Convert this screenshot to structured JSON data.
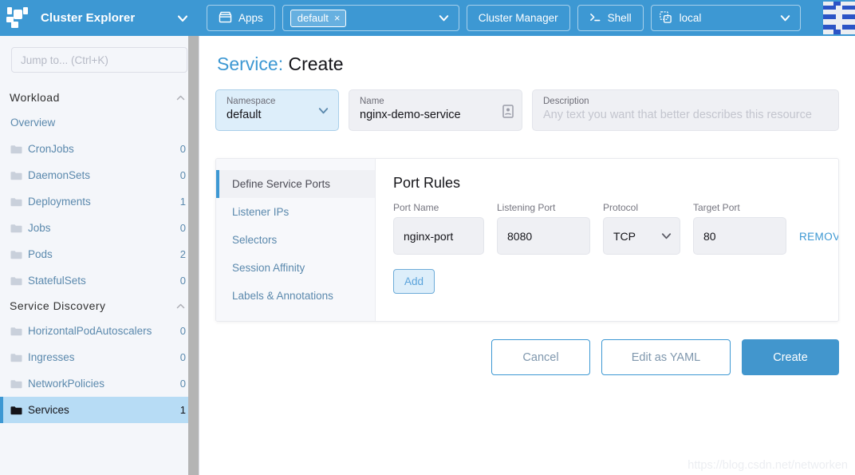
{
  "brand": {
    "logo_icon": "rancher-cow-logo",
    "title": "Cluster Explorer",
    "chevron_icon": "chevron-down-icon"
  },
  "topbar": {
    "apps_label": "Apps",
    "apps_icon": "apps-store-icon",
    "namespace_pill": "default",
    "namespace_pill_close": "×",
    "namespace_caret_icon": "chevron-down-icon",
    "cluster_manager_label": "Cluster Manager",
    "shell_label": "Shell",
    "shell_icon": "terminal-prompt-icon",
    "cluster_name": "local",
    "cluster_icon": "cluster-nodes-icon",
    "cluster_caret_icon": "chevron-down-icon",
    "avatar_icon": "user-avatar-flag"
  },
  "sidebar": {
    "search_placeholder": "Jump to... (Ctrl+K)",
    "scrollbar_icon": "vertical-scrollbar",
    "groups": [
      {
        "title": "Workload",
        "collapse_icon": "chevron-up-icon",
        "items": [
          {
            "label": "Overview",
            "count": "",
            "icon": "",
            "active": false
          },
          {
            "label": "CronJobs",
            "count": "0",
            "icon": "folder-icon",
            "active": false
          },
          {
            "label": "DaemonSets",
            "count": "0",
            "icon": "folder-icon",
            "active": false
          },
          {
            "label": "Deployments",
            "count": "1",
            "icon": "folder-icon",
            "active": false
          },
          {
            "label": "Jobs",
            "count": "0",
            "icon": "folder-icon",
            "active": false
          },
          {
            "label": "Pods",
            "count": "2",
            "icon": "folder-icon",
            "active": false
          },
          {
            "label": "StatefulSets",
            "count": "0",
            "icon": "folder-icon",
            "active": false
          }
        ]
      },
      {
        "title": "Service Discovery",
        "collapse_icon": "chevron-up-icon",
        "items": [
          {
            "label": "HorizontalPodAutoscalers",
            "count": "0",
            "icon": "folder-icon",
            "active": false
          },
          {
            "label": "Ingresses",
            "count": "0",
            "icon": "folder-icon",
            "active": false
          },
          {
            "label": "NetworkPolicies",
            "count": "0",
            "icon": "folder-icon",
            "active": false
          },
          {
            "label": "Services",
            "count": "1",
            "icon": "folder-icon",
            "active": true
          }
        ]
      }
    ]
  },
  "page": {
    "title_accent": "Service:",
    "title_rest": "Create",
    "namespace_label": "Namespace",
    "namespace_value": "default",
    "namespace_caret_icon": "chevron-down-icon",
    "name_label": "Name",
    "name_value": "nginx-demo-service",
    "name_icon": "id-badge-icon",
    "description_label": "Description",
    "description_placeholder": "Any text you want that better describes this resource"
  },
  "card": {
    "tabs": [
      {
        "label": "Define Service Ports",
        "active": true
      },
      {
        "label": "Listener IPs",
        "active": false
      },
      {
        "label": "Selectors",
        "active": false
      },
      {
        "label": "Session Affinity",
        "active": false
      },
      {
        "label": "Labels & Annotations",
        "active": false
      }
    ],
    "panel_title": "Port Rules",
    "columns": {
      "port_name": "Port Name",
      "listening_port": "Listening Port",
      "protocol": "Protocol",
      "target_port": "Target Port"
    },
    "rows": [
      {
        "port_name": "nginx-port",
        "listening_port": "8080",
        "protocol": "TCP",
        "protocol_caret_icon": "chevron-down-icon",
        "target_port": "80",
        "remove_label": "REMOVE"
      }
    ],
    "add_label": "Add"
  },
  "footer": {
    "cancel_label": "Cancel",
    "yaml_label": "Edit as YAML",
    "create_label": "Create"
  },
  "watermark": "https://blog.csdn.net/networken",
  "colors": {
    "brand_blue": "#3d98d3",
    "create_blue": "#4296cd",
    "link_blue": "#5b89ad",
    "active_nav": "#b7dcf5",
    "field_grey": "#eff0f4",
    "sidebar_bg": "#f4f6fa"
  }
}
